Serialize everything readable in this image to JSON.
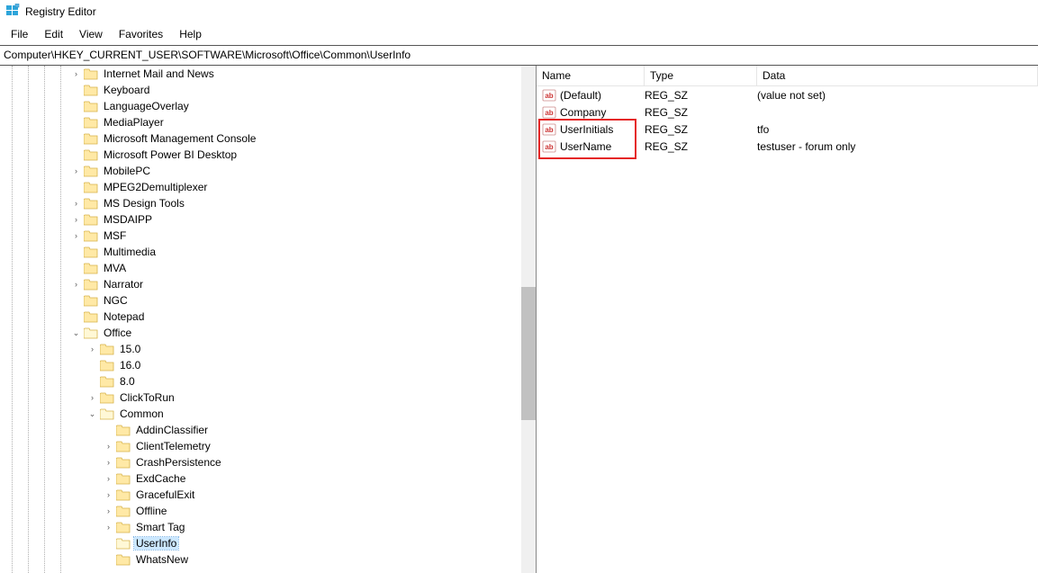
{
  "window": {
    "title": "Registry Editor"
  },
  "menu": {
    "file": "File",
    "edit": "Edit",
    "view": "View",
    "favorites": "Favorites",
    "help": "Help"
  },
  "address": "Computer\\HKEY_CURRENT_USER\\SOFTWARE\\Microsoft\\Office\\Common\\UserInfo",
  "headers": {
    "name": "Name",
    "type": "Type",
    "data": "Data"
  },
  "values": [
    {
      "name": "(Default)",
      "type": "REG_SZ",
      "data": "(value not set)"
    },
    {
      "name": "Company",
      "type": "REG_SZ",
      "data": ""
    },
    {
      "name": "UserInitials",
      "type": "REG_SZ",
      "data": "tfo"
    },
    {
      "name": "UserName",
      "type": "REG_SZ",
      "data": "testuser - forum only"
    }
  ],
  "tree": [
    {
      "depth": 4,
      "exp": "closed",
      "label": "Internet Mail and News"
    },
    {
      "depth": 4,
      "exp": "none",
      "label": "Keyboard"
    },
    {
      "depth": 4,
      "exp": "none",
      "label": "LanguageOverlay"
    },
    {
      "depth": 4,
      "exp": "none",
      "label": "MediaPlayer"
    },
    {
      "depth": 4,
      "exp": "none",
      "label": "Microsoft Management Console"
    },
    {
      "depth": 4,
      "exp": "none",
      "label": "Microsoft Power BI Desktop"
    },
    {
      "depth": 4,
      "exp": "closed",
      "label": "MobilePC"
    },
    {
      "depth": 4,
      "exp": "none",
      "label": "MPEG2Demultiplexer"
    },
    {
      "depth": 4,
      "exp": "closed",
      "label": "MS Design Tools"
    },
    {
      "depth": 4,
      "exp": "closed",
      "label": "MSDAIPP"
    },
    {
      "depth": 4,
      "exp": "closed",
      "label": "MSF"
    },
    {
      "depth": 4,
      "exp": "none",
      "label": "Multimedia"
    },
    {
      "depth": 4,
      "exp": "none",
      "label": "MVA"
    },
    {
      "depth": 4,
      "exp": "closed",
      "label": "Narrator"
    },
    {
      "depth": 4,
      "exp": "none",
      "label": "NGC"
    },
    {
      "depth": 4,
      "exp": "none",
      "label": "Notepad"
    },
    {
      "depth": 4,
      "exp": "open",
      "label": "Office"
    },
    {
      "depth": 5,
      "exp": "closed",
      "label": "15.0"
    },
    {
      "depth": 5,
      "exp": "none",
      "label": "16.0"
    },
    {
      "depth": 5,
      "exp": "none",
      "label": "8.0"
    },
    {
      "depth": 5,
      "exp": "closed",
      "label": "ClickToRun"
    },
    {
      "depth": 5,
      "exp": "open",
      "label": "Common"
    },
    {
      "depth": 6,
      "exp": "none",
      "label": "AddinClassifier"
    },
    {
      "depth": 6,
      "exp": "closed",
      "label": "ClientTelemetry"
    },
    {
      "depth": 6,
      "exp": "closed",
      "label": "CrashPersistence"
    },
    {
      "depth": 6,
      "exp": "closed",
      "label": "ExdCache"
    },
    {
      "depth": 6,
      "exp": "closed",
      "label": "GracefulExit"
    },
    {
      "depth": 6,
      "exp": "closed",
      "label": "Offline"
    },
    {
      "depth": 6,
      "exp": "closed",
      "label": "Smart Tag"
    },
    {
      "depth": 6,
      "exp": "none",
      "label": "UserInfo",
      "selected": true
    },
    {
      "depth": 6,
      "exp": "none",
      "label": "WhatsNew"
    }
  ]
}
